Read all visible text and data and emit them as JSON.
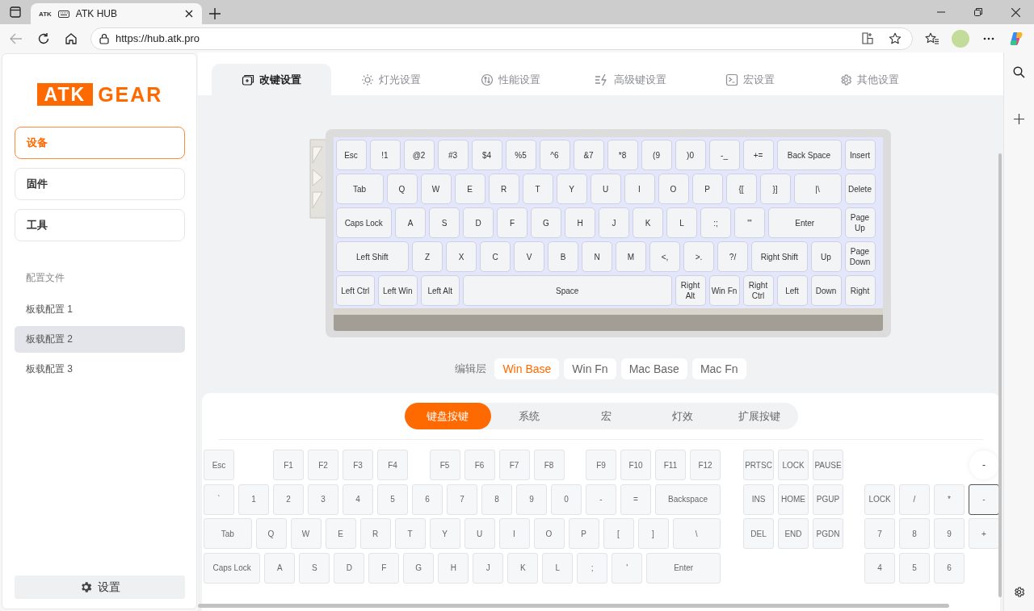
{
  "browser": {
    "tab": {
      "favicon_text": "ATK",
      "title": "ATK HUB"
    },
    "url": "https://hub.atk.pro"
  },
  "sidebar": {
    "logo": {
      "boxed": "ATK",
      "text": "GEAR"
    },
    "nav": [
      {
        "label": "设备",
        "selected": true
      },
      {
        "label": "固件",
        "selected": false
      },
      {
        "label": "工具",
        "selected": false
      }
    ],
    "profiles_heading": "配置文件",
    "profiles": [
      {
        "label": "板载配置 1",
        "selected": false
      },
      {
        "label": "板载配置 2",
        "selected": true
      },
      {
        "label": "板载配置 3",
        "selected": false
      }
    ],
    "settings_button": "设置"
  },
  "tabs": [
    {
      "label": "改键设置",
      "kind": "remap",
      "selected": true
    },
    {
      "label": "灯光设置",
      "kind": "lighting",
      "selected": false
    },
    {
      "label": "性能设置",
      "kind": "performance",
      "selected": false
    },
    {
      "label": "高级键设置",
      "kind": "advanced",
      "selected": false
    },
    {
      "label": "宏设置",
      "kind": "macro",
      "selected": false
    },
    {
      "label": "其他设置",
      "kind": "other",
      "selected": false
    }
  ],
  "keyboard": {
    "rows": [
      {
        "keys": [
          "Esc",
          "!1",
          "@2",
          "#3",
          "$4",
          "%5",
          "^6",
          "&7",
          "*8",
          "(9",
          ")0",
          "-_",
          "+=",
          "Back Space",
          "Insert"
        ]
      },
      {
        "keys": [
          "Tab",
          "Q",
          "W",
          "E",
          "R",
          "T",
          "Y",
          "U",
          "I",
          "O",
          "P",
          "{[",
          "}]",
          "|\\",
          "Delete"
        ]
      },
      {
        "keys": [
          "Caps Lock",
          "A",
          "S",
          "D",
          "F",
          "G",
          "H",
          "J",
          "K",
          "L",
          ":;",
          "\"'",
          "Enter",
          "Page Up"
        ]
      },
      {
        "keys": [
          "Left Shift",
          "Z",
          "X",
          "C",
          "V",
          "B",
          "N",
          "M",
          "<,",
          ">.",
          "?/",
          "Right Shift",
          "Up",
          "Page Down"
        ]
      },
      {
        "keys": [
          "Left Ctrl",
          "Left Win",
          "Left Alt",
          "Space",
          "Right Alt",
          "Win Fn",
          "Right Ctrl",
          "Left",
          "Down",
          "Right"
        ]
      }
    ]
  },
  "layers": {
    "label": "编辑层",
    "options": [
      {
        "label": "Win Base",
        "selected": true
      },
      {
        "label": "Win Fn",
        "selected": false
      },
      {
        "label": "Mac Base",
        "selected": false
      },
      {
        "label": "Mac Fn",
        "selected": false
      }
    ]
  },
  "key_picker": {
    "categories": [
      {
        "label": "键盘按键",
        "selected": true
      },
      {
        "label": "系统",
        "selected": false
      },
      {
        "label": "宏",
        "selected": false
      },
      {
        "label": "灯效",
        "selected": false
      },
      {
        "label": "扩展按键",
        "selected": false
      }
    ],
    "main_rows": [
      [
        "Esc",
        "F1",
        "F2",
        "F3",
        "F4",
        "F5",
        "F6",
        "F7",
        "F8",
        "F9",
        "F10",
        "F11",
        "F12"
      ],
      [
        "`",
        "1",
        "2",
        "3",
        "4",
        "5",
        "6",
        "7",
        "8",
        "9",
        "0",
        "-",
        "=",
        "Backspace"
      ],
      [
        "Tab",
        "Q",
        "W",
        "E",
        "R",
        "T",
        "Y",
        "U",
        "I",
        "O",
        "P",
        "[",
        "]",
        "\\"
      ],
      [
        "Caps Lock",
        "A",
        "S",
        "D",
        "F",
        "G",
        "H",
        "J",
        "K",
        "L",
        ";",
        "'",
        "Enter"
      ]
    ],
    "nav_rows": [
      [
        "PRTSC",
        "LOCK",
        "PAUSE"
      ],
      [
        "INS",
        "HOME",
        "PGUP"
      ],
      [
        "DEL",
        "END",
        "PGDN"
      ]
    ],
    "tooltip": "-",
    "numpad": [
      {
        "label": "LOCK",
        "selected": false
      },
      {
        "label": "/",
        "selected": false
      },
      {
        "label": "*",
        "selected": false
      },
      {
        "label": "-",
        "selected": true
      },
      {
        "label": "7",
        "selected": false
      },
      {
        "label": "8",
        "selected": false
      },
      {
        "label": "9",
        "selected": false
      },
      {
        "label": "+",
        "selected": false
      },
      {
        "label": "4",
        "selected": false
      },
      {
        "label": "5",
        "selected": false
      },
      {
        "label": "6",
        "selected": false
      }
    ]
  }
}
